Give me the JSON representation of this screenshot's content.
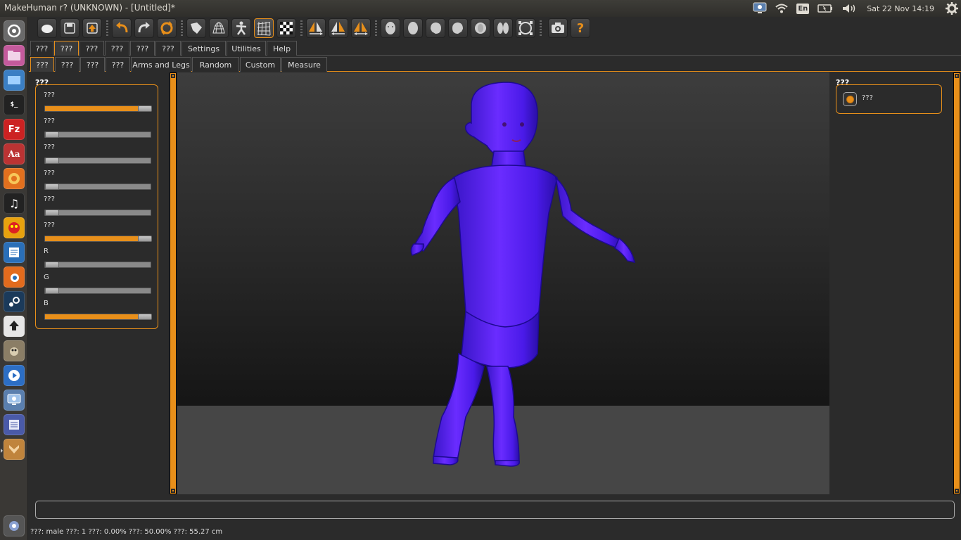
{
  "window": {
    "title": "MakeHuman r? (UNKNOWN) - [Untitled]*"
  },
  "top_panel": {
    "lang": "En",
    "clock": "Sat 22 Nov 14:19"
  },
  "toolbar": {
    "groups": [
      [
        "new-icon",
        "save-icon",
        "export-icon"
      ],
      [
        "undo-icon",
        "redo-icon",
        "reset-icon"
      ],
      [
        "smooth-icon",
        "wireframe-icon",
        "pose-icon",
        "grid-icon",
        "checker-icon"
      ],
      [
        "symmetry-right-icon",
        "symmetry-left-icon",
        "symmetry-icon"
      ],
      [
        "front-view-icon",
        "back-view-icon",
        "left-view-icon",
        "right-view-icon",
        "top-view-icon",
        "bottom-view-icon",
        "reset-camera-icon"
      ],
      [
        "screenshot-icon",
        "help-icon"
      ]
    ]
  },
  "main_tabs": [
    "???",
    "???",
    "???",
    "???",
    "???",
    "???",
    "Settings",
    "Utilities",
    "Help"
  ],
  "main_tab_active": 1,
  "sub_tabs": [
    "???",
    "???",
    "???",
    "???",
    "Arms and Legs",
    "Random",
    "Custom",
    "Measure"
  ],
  "sub_tab_active": 0,
  "left_panel": {
    "title": "???",
    "sliders": [
      {
        "label": "???",
        "value": 1.0
      },
      {
        "label": "???",
        "value": 0.0
      },
      {
        "label": "???",
        "value": 0.0
      },
      {
        "label": "???",
        "value": 0.0
      },
      {
        "label": "???",
        "value": 0.0
      },
      {
        "label": "???",
        "value": 1.0
      },
      {
        "label": "R",
        "value": 0.0
      },
      {
        "label": "G",
        "value": 0.0
      },
      {
        "label": "B",
        "value": 1.0
      }
    ]
  },
  "right_panel": {
    "title": "???",
    "radio_label": "???"
  },
  "command": {
    "value": ""
  },
  "status": "???: male ???: 1 ???: 0.00% ???: 50.00% ???: 55.27 cm",
  "colors": {
    "accent": "#e88f1a",
    "model": "#5a1ef0"
  }
}
